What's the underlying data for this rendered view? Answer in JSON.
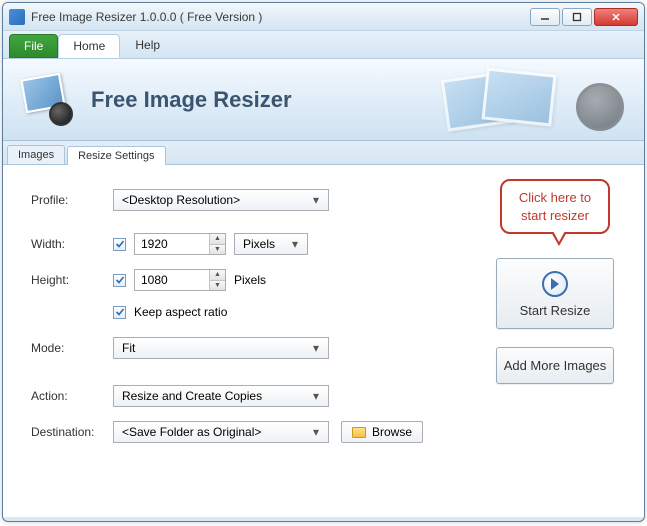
{
  "window": {
    "title": "Free Image Resizer 1.0.0.0 ( Free Version )"
  },
  "menu": {
    "file": "File",
    "home": "Home",
    "help": "Help"
  },
  "banner": {
    "title": "Free Image Resizer"
  },
  "tabs": {
    "images": "Images",
    "resize_settings": "Resize Settings"
  },
  "form": {
    "profile_label": "Profile:",
    "profile_value": "<Desktop Resolution>",
    "width_label": "Width:",
    "width_value": "1920",
    "width_unit": "Pixels",
    "height_label": "Height:",
    "height_value": "1080",
    "height_unit": "Pixels",
    "keep_aspect": "Keep aspect ratio",
    "mode_label": "Mode:",
    "mode_value": "Fit",
    "action_label": "Action:",
    "action_value": "Resize and Create Copies",
    "destination_label": "Destination:",
    "destination_value": "<Save Folder as Original>",
    "browse": "Browse"
  },
  "right": {
    "callout": "Click here to start resizer",
    "start": "Start Resize",
    "add_more": "Add More Images"
  }
}
